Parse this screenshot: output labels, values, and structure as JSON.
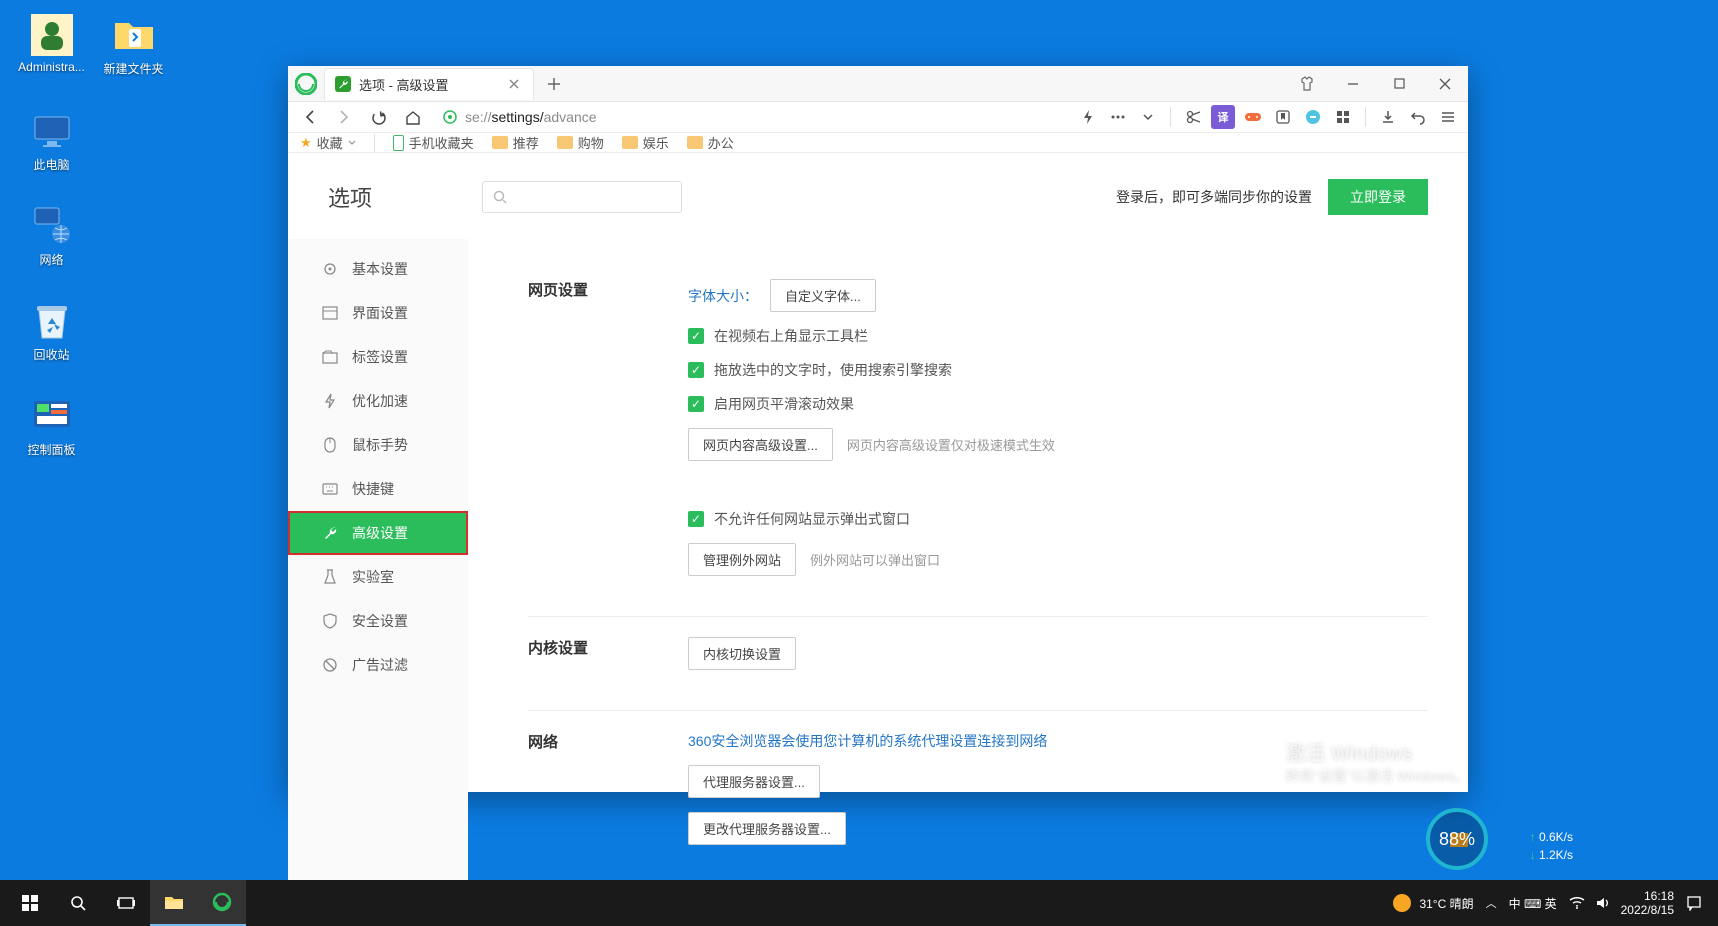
{
  "desktop": {
    "icons": [
      {
        "label": "Administra...",
        "name": "user-admin-icon"
      },
      {
        "label": "新建文件夹",
        "name": "new-folder-icon"
      },
      {
        "label": "此电脑",
        "name": "this-pc-icon"
      },
      {
        "label": "网络",
        "name": "network-icon"
      },
      {
        "label": "回收站",
        "name": "recycle-bin-icon"
      },
      {
        "label": "控制面板",
        "name": "control-panel-icon"
      }
    ]
  },
  "browser": {
    "tab_title": "选项 - 高级设置",
    "url_scheme": "se://",
    "url_seg1": "settings/",
    "url_seg2": "advance",
    "bookmarks": {
      "fav": "收藏",
      "mobile": "手机收藏夹",
      "items": [
        "推荐",
        "购物",
        "娱乐",
        "办公"
      ]
    }
  },
  "page": {
    "title": "选项",
    "search_placeholder": "",
    "login_tip": "登录后，即可多端同步你的设置",
    "login_btn": "立即登录"
  },
  "sidebar": {
    "items": [
      {
        "label": "基本设置",
        "name": "basic-settings"
      },
      {
        "label": "界面设置",
        "name": "interface-settings"
      },
      {
        "label": "标签设置",
        "name": "tab-settings"
      },
      {
        "label": "优化加速",
        "name": "optimization"
      },
      {
        "label": "鼠标手势",
        "name": "mouse-gestures"
      },
      {
        "label": "快捷键",
        "name": "shortcuts"
      },
      {
        "label": "高级设置",
        "name": "advanced-settings",
        "active": true
      },
      {
        "label": "实验室",
        "name": "lab"
      },
      {
        "label": "安全设置",
        "name": "security-settings"
      },
      {
        "label": "广告过滤",
        "name": "ad-filter"
      }
    ]
  },
  "settings": {
    "sections": {
      "page_settings": {
        "title": "网页设置",
        "font_label": "字体大小：",
        "font_btn": "自定义字体...",
        "chk1": "在视频右上角显示工具栏",
        "chk2": "拖放选中的文字时，使用搜索引擎搜索",
        "chk3": "启用网页平滑滚动效果",
        "adv_btn": "网页内容高级设置...",
        "adv_hint": "网页内容高级设置仅对极速模式生效",
        "chk4": "不允许任何网站显示弹出式窗口",
        "manage_btn": "管理例外网站",
        "manage_hint": "例外网站可以弹出窗口"
      },
      "kernel": {
        "title": "内核设置",
        "btn": "内核切换设置"
      },
      "network": {
        "title": "网络",
        "desc": "360安全浏览器会使用您计算机的系统代理设置连接到网络",
        "btn1": "代理服务器设置...",
        "btn2": "更改代理服务器设置..."
      }
    }
  },
  "watermark": {
    "l1": "激活 Windows",
    "l2": "转到\"设置\"以激活 Windows。"
  },
  "net_badge": "88%",
  "net_stats": {
    "up": "0.6K/s",
    "dn": "1.2K/s"
  },
  "taskbar": {
    "weather": "31°C 晴朗",
    "ime": "中 ⌨ 英",
    "time": "16:18",
    "date": "2022/8/15"
  }
}
